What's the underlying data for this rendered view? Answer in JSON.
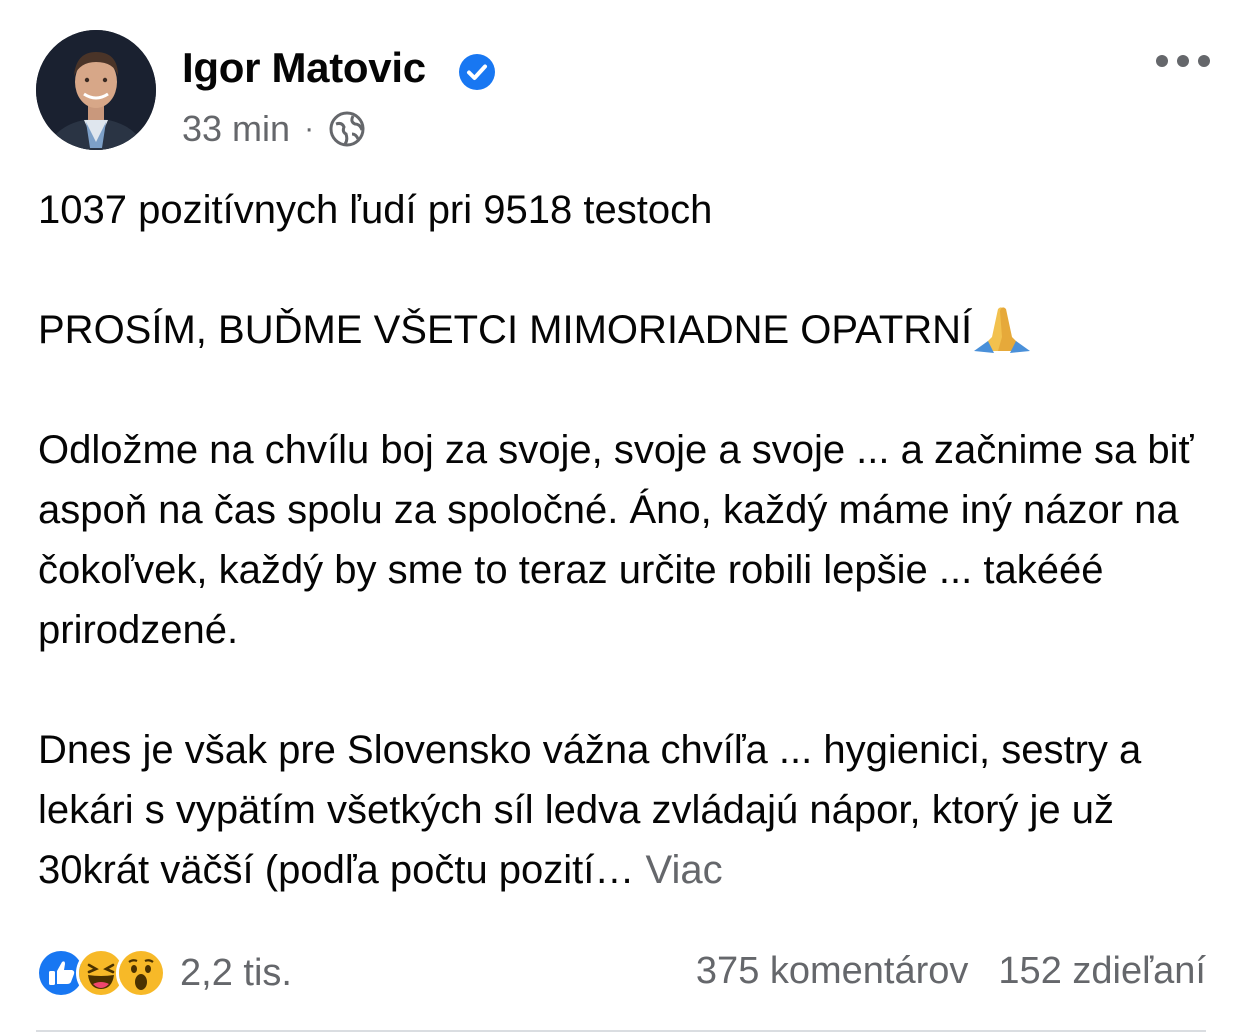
{
  "header": {
    "author": "Igor Matovic",
    "time": "33 min",
    "separator": "·",
    "privacy_icon": "globe-icon",
    "verified_icon": "verified-badge-icon",
    "more_icon": "more-options-icon"
  },
  "post": {
    "line1": "1037 pozitívnych ľudí pri 9518 testoch",
    "line2": "PROSÍM, BUĎME VŠETCI MIMORIADNE OPATRNÍ",
    "line2_emoji": "folded-hands-emoji",
    "paragraph3": "Odložme na chvílu boj za svoje, svoje a svoje ... a začnime sa biť aspoň na čas spolu za spoločné. Áno, každý máme iný názor na čokoľvek, každý by sme to teraz určite robili lepšie ... takééé prirodzené.",
    "paragraph4": "Dnes je však pre Slovensko vážna chvíľa ... hygienici, sestry a lekári s vypätím všetkých síl ledva zvládajú nápor, ktorý je už 30krát väčší (podľa počtu pozití…",
    "see_more": "Viac"
  },
  "footer": {
    "reactions": [
      "like-reaction-icon",
      "haha-reaction-icon",
      "wow-reaction-icon"
    ],
    "reaction_count": "2,2 tis.",
    "comments": "375 komentárov",
    "shares": "152 zdieľaní"
  },
  "colors": {
    "text": "#050505",
    "secondary": "#65676b",
    "accent": "#1877f2"
  }
}
